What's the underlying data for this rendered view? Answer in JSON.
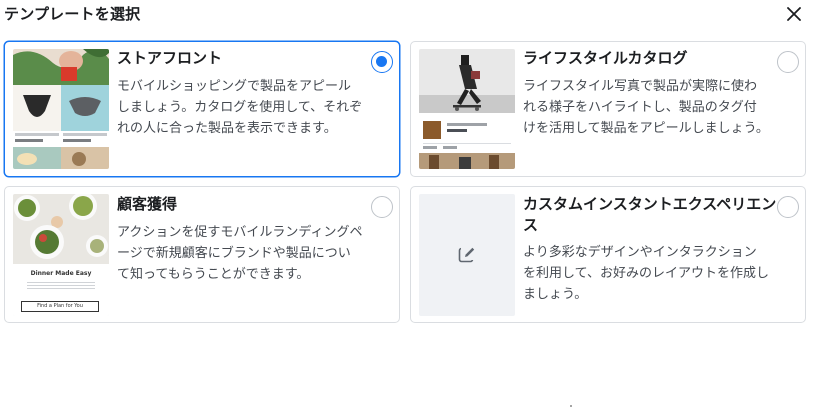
{
  "dialog": {
    "title": "テンプレートを選択"
  },
  "cards": [
    {
      "title": "ストアフロント",
      "description": "モバイルショッピングで製品をアピールしましょう。カタログを使用して、それぞれの人に合った製品を表示できます。",
      "selected": true
    },
    {
      "title": "ライフスタイルカタログ",
      "description": "ライフスタイル写真で製品が実際に使われる様子をハイライトし、製品のタグ付けを活用して製品をアピールしましょう。",
      "selected": false
    },
    {
      "title": "顧客獲得",
      "description": "アクションを促すモバイルランディングページで新規顧客にブランドや製品について知ってもらうことができます。",
      "selected": false,
      "thumb_heading": "Dinner Made Easy",
      "thumb_button": "Find a Plan for You"
    },
    {
      "title": "カスタムインスタントエクスペリエンス",
      "description": "より多彩なデザインやインタラクションを利用して、お好みのレイアウトを作成しましょう。",
      "selected": false
    }
  ],
  "colors": {
    "accent": "#1877f2",
    "border": "#dadde1",
    "placeholder": "#f0f2f5"
  },
  "icons": {
    "close": "close-icon",
    "edit": "edit-icon"
  }
}
